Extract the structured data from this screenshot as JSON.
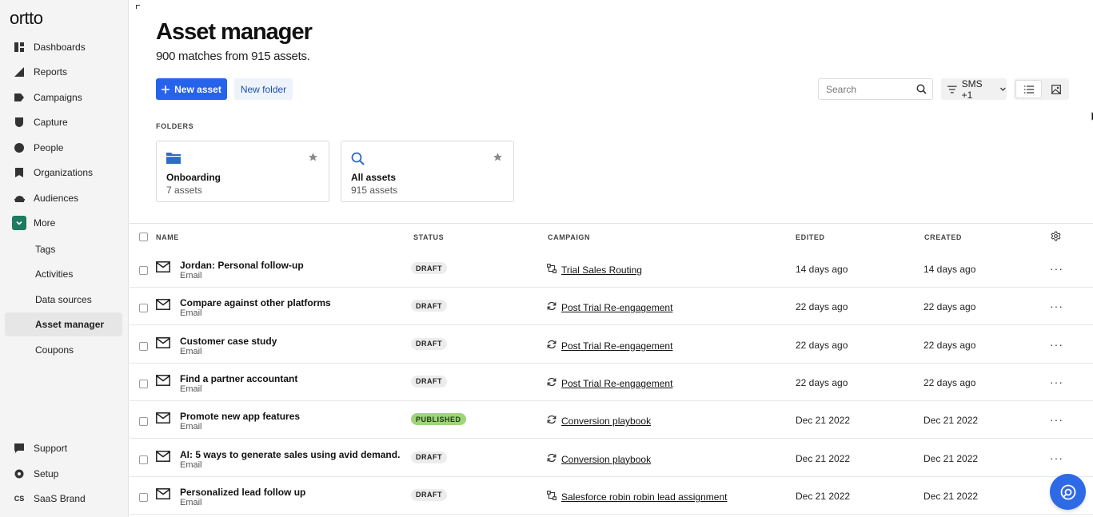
{
  "app": {
    "logo": "ortto"
  },
  "sidebar": {
    "items": [
      {
        "label": "Dashboards",
        "icon": "dashboard-icon"
      },
      {
        "label": "Reports",
        "icon": "reports-icon"
      },
      {
        "label": "Campaigns",
        "icon": "campaigns-icon"
      },
      {
        "label": "Capture",
        "icon": "capture-icon"
      },
      {
        "label": "People",
        "icon": "people-icon"
      },
      {
        "label": "Organizations",
        "icon": "organizations-icon"
      },
      {
        "label": "Audiences",
        "icon": "audiences-icon"
      },
      {
        "label": "More",
        "icon": "chevron-down-icon"
      }
    ],
    "sub_items": [
      {
        "label": "Tags",
        "active": false
      },
      {
        "label": "Activities",
        "active": false
      },
      {
        "label": "Data sources",
        "active": false
      },
      {
        "label": "Asset manager",
        "active": true
      },
      {
        "label": "Coupons",
        "active": false
      }
    ],
    "bottom": [
      {
        "label": "Support",
        "icon": "support-icon"
      },
      {
        "label": "Setup",
        "icon": "setup-icon"
      },
      {
        "label": "SaaS Brand",
        "icon": "CS"
      }
    ]
  },
  "header": {
    "title": "Asset manager",
    "subtitle": "900 matches from 915 assets."
  },
  "toolbar": {
    "new_asset_label": "New asset",
    "new_folder_label": "New folder",
    "search_placeholder": "Search",
    "filter_label": "SMS +1"
  },
  "folders": {
    "label": "FOLDERS",
    "items": [
      {
        "name": "Onboarding",
        "count": "7 assets",
        "icon": "folder-icon"
      },
      {
        "name": "All assets",
        "count": "915 assets",
        "icon": "search-icon"
      }
    ]
  },
  "table": {
    "columns": {
      "name": "NAME",
      "status": "STATUS",
      "campaign": "CAMPAIGN",
      "edited": "EDITED",
      "created": "CREATED"
    },
    "rows": [
      {
        "name": "Jordan: Personal follow-up",
        "type": "Email",
        "status": "DRAFT",
        "campaign_icon": "journey-icon",
        "campaign": "Trial Sales Routing",
        "edited": "14 days ago",
        "created": "14 days ago"
      },
      {
        "name": "Compare against other platforms",
        "type": "Email",
        "status": "DRAFT",
        "campaign_icon": "recurring-icon",
        "campaign": "Post Trial Re-engagement",
        "edited": "22 days ago",
        "created": "22 days ago"
      },
      {
        "name": "Customer case study",
        "type": "Email",
        "status": "DRAFT",
        "campaign_icon": "recurring-icon",
        "campaign": "Post Trial Re-engagement",
        "edited": "22 days ago",
        "created": "22 days ago"
      },
      {
        "name": "Find a partner accountant",
        "type": "Email",
        "status": "DRAFT",
        "campaign_icon": "recurring-icon",
        "campaign": "Post Trial Re-engagement",
        "edited": "22 days ago",
        "created": "22 days ago"
      },
      {
        "name": "Promote new app features",
        "type": "Email",
        "status": "PUBLISHED",
        "campaign_icon": "recurring-icon",
        "campaign": "Conversion playbook",
        "edited": "Dec 21 2022",
        "created": "Dec 21 2022"
      },
      {
        "name": "AI: 5 ways to generate sales using avid demand.",
        "type": "Email",
        "status": "DRAFT",
        "campaign_icon": "recurring-icon",
        "campaign": "Conversion playbook",
        "edited": "Dec 21 2022",
        "created": "Dec 21 2022"
      },
      {
        "name": "Personalized lead follow up",
        "type": "Email",
        "status": "DRAFT",
        "campaign_icon": "journey-icon",
        "campaign": "Salesforce robin robin lead assignment",
        "edited": "Dec 21 2022",
        "created": "Dec 21 2022"
      }
    ]
  },
  "colors": {
    "primary": "#2563eb",
    "published": "#9fd47a",
    "more_accent": "#1f7a5f"
  }
}
